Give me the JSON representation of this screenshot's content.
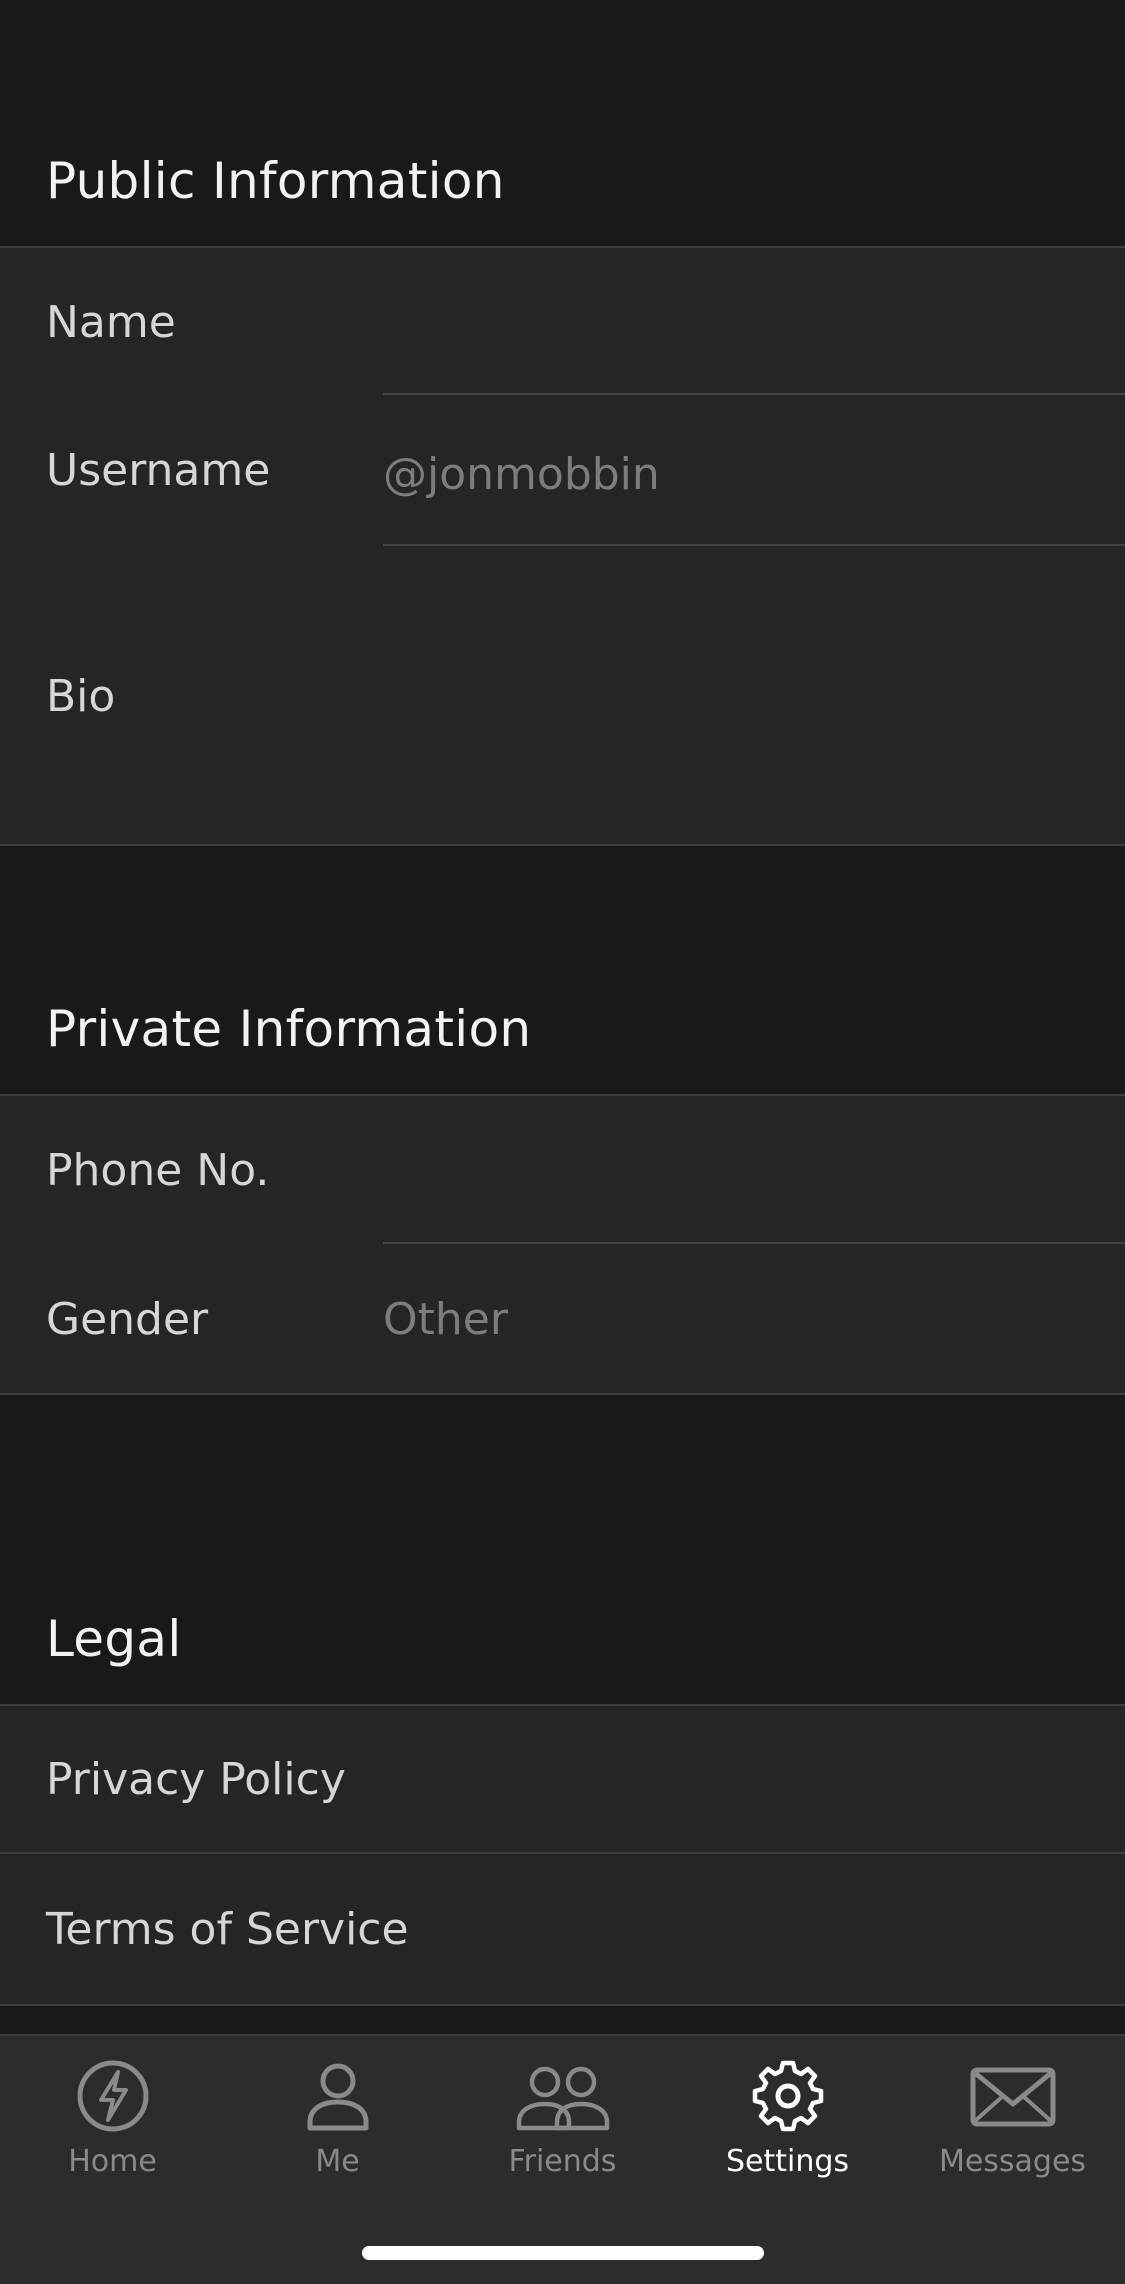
{
  "public_section": {
    "title": "Public Information",
    "name_label": "Name",
    "name_value": "",
    "username_label": "Username",
    "username_value": "@jonmobbin",
    "bio_label": "Bio",
    "bio_value": ""
  },
  "private_section": {
    "title": "Private Information",
    "phone_label": "Phone No.",
    "phone_value": "",
    "gender_label": "Gender",
    "gender_value": "Other"
  },
  "legal_section": {
    "title": "Legal",
    "privacy_label": "Privacy Policy",
    "terms_label": "Terms of Service"
  },
  "tabbar": {
    "items": [
      {
        "label": "Home",
        "icon": "lightning-icon",
        "active": false
      },
      {
        "label": "Me",
        "icon": "person-icon",
        "active": false
      },
      {
        "label": "Friends",
        "icon": "people-icon",
        "active": false
      },
      {
        "label": "Settings",
        "icon": "gear-icon",
        "active": true
      },
      {
        "label": "Messages",
        "icon": "envelope-icon",
        "active": false
      }
    ]
  },
  "colors": {
    "background": "#191919",
    "group_background": "#252525",
    "tabbar_background": "#2d2b2b",
    "active_tab": "#ffffff",
    "inactive_tab": "#8a8a8a"
  }
}
